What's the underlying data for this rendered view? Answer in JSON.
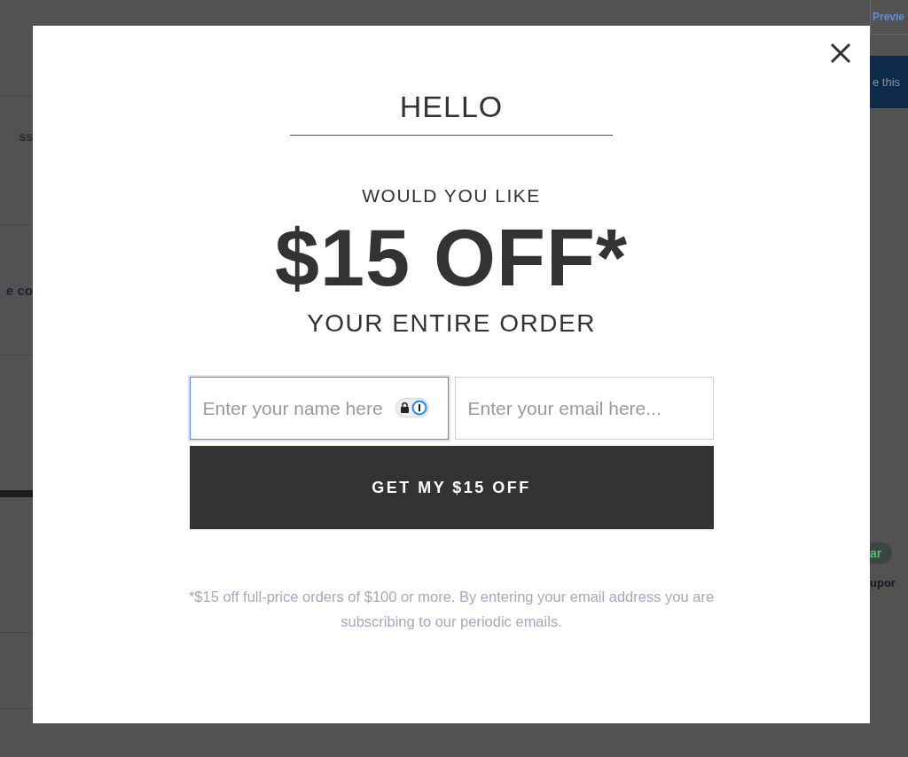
{
  "background": {
    "left_texts": [
      "ss",
      "e co"
    ],
    "preview_link": "Previe",
    "action_button": "e this",
    "tag": "ar",
    "right_text": "upor"
  },
  "modal": {
    "greeting": "HELLO",
    "lead": "WOULD YOU LIKE",
    "offer": "$15 OFF*",
    "subline": "YOUR ENTIRE ORDER",
    "fields": [
      {
        "placeholder": "Enter your name here",
        "focused": true
      },
      {
        "placeholder": "Enter your email here...",
        "focused": false
      }
    ],
    "submit": "GET MY $15 OFF",
    "footnote": "*$15 off full-price orders of $100 or more. By entering your email address you are subscribing to our periodic emails."
  }
}
